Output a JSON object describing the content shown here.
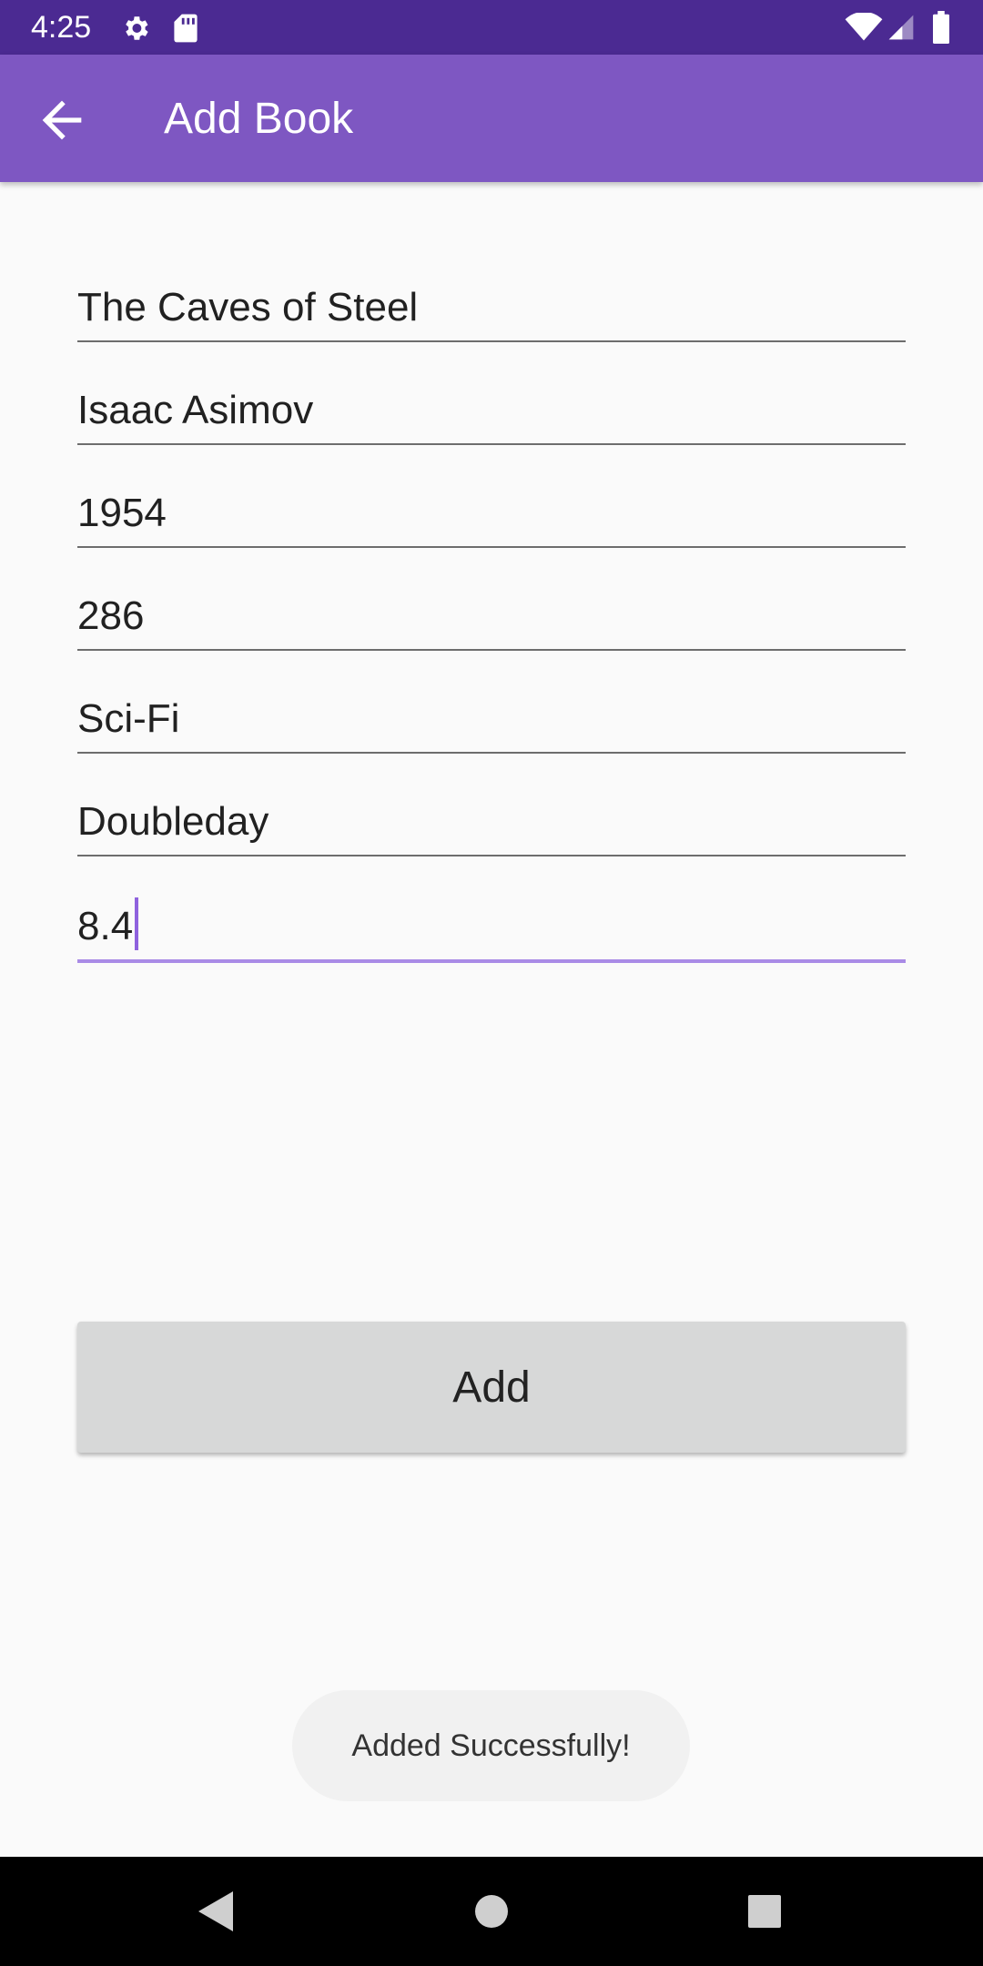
{
  "status_bar": {
    "time": "4:25",
    "icons": [
      "gear-icon",
      "sd-card-icon",
      "wifi-icon",
      "signal-icon",
      "battery-icon"
    ]
  },
  "app_bar": {
    "title": "Add Book",
    "back_icon": "arrow-back-icon",
    "color": "#7e57c2"
  },
  "form": {
    "fields": [
      {
        "value": "The Caves of Steel"
      },
      {
        "value": "Isaac Asimov"
      },
      {
        "value": "1954"
      },
      {
        "value": "286"
      },
      {
        "value": "Sci-Fi"
      },
      {
        "value": "Doubleday"
      },
      {
        "value": "8.4",
        "focused": true
      }
    ],
    "add_button_label": "Add"
  },
  "toast": {
    "message": "Added Successfully!"
  },
  "nav_bar": {
    "icons": [
      "nav-back-icon",
      "nav-home-icon",
      "nav-recents-icon"
    ]
  },
  "colors": {
    "status_bar": "#4b2a92",
    "accent": "#a98be6",
    "background": "#fafafa"
  }
}
